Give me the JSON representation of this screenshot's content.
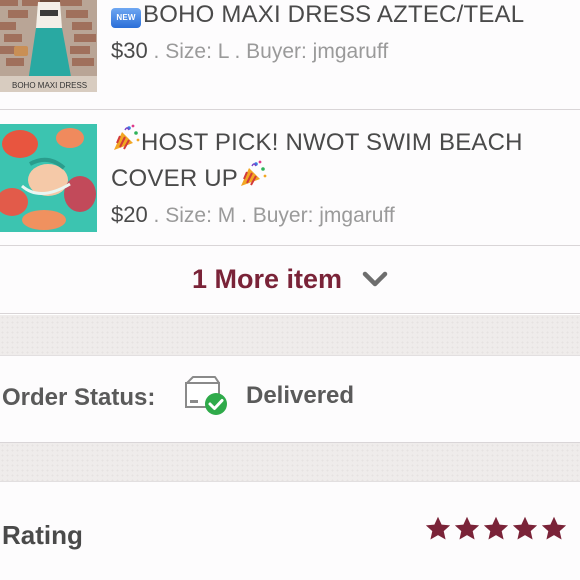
{
  "items": [
    {
      "badge": "NEW",
      "title": "BOHO MAXI DRESS AZTEC/TEAL",
      "price": "$30",
      "details": " . Size: L . Buyer: jmgaruff",
      "thumb_caption": "BOHO MAXI DRESS"
    },
    {
      "title_line1": "HOST PICK! NWOT SWIM BEACH",
      "title_line2": "COVER UP",
      "price": "$20",
      "details": " . Size: M . Buyer: jmgaruff"
    }
  ],
  "more": {
    "label": "1 More item",
    "icon": "chevron-down-icon"
  },
  "order_status": {
    "label": "Order Status:",
    "value": "Delivered",
    "icon": "delivered-box-icon"
  },
  "rating": {
    "label": "Rating",
    "stars": 5,
    "max_stars": 5
  },
  "colors": {
    "accent": "#7a2338",
    "text": "#4a4a4a",
    "muted": "#9a9a9a",
    "status_green": "#2faa4a"
  }
}
